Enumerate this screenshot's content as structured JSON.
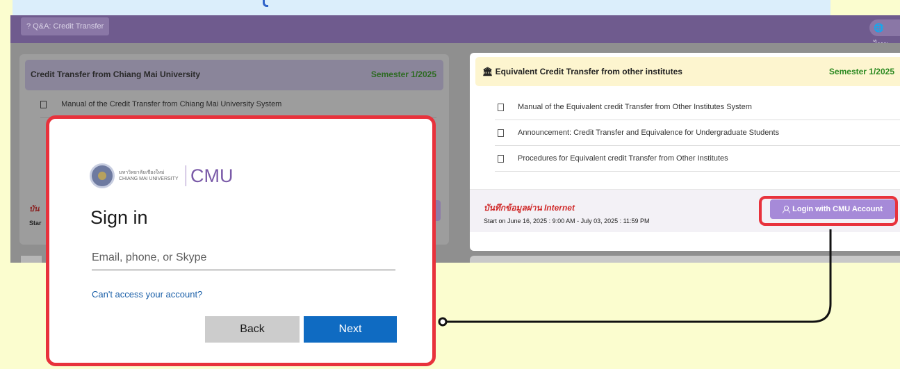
{
  "header": {
    "qa_button": "? Q&A: Credit Transfer",
    "language_button": "🌐 ไทย"
  },
  "left_panel": {
    "title": "Credit Transfer from Chiang Mai University",
    "semester": "Semester 1/2025",
    "items": [
      "Manual of the Credit Transfer from Chiang Mai University System"
    ],
    "record_fragment": "บัน",
    "start_fragment": "Star"
  },
  "right_panel": {
    "title": "Equivalent Credit Transfer from other institutes",
    "semester": "Semester 1/2025",
    "items": [
      "Manual of the Equivalent credit Transfer from Other Institutes System",
      "Announcement: Credit Transfer and Equivalence for Undergraduate Students",
      "Procedures for Equivalent credit Transfer from Other Institutes"
    ],
    "record_text": "บันทึกข้อมูลผ่าน Internet",
    "start_text": "Start on June 16, 2025 : 9:00 AM - July 03, 2025 : 11:59 PM",
    "login_button": "Login with CMU Account"
  },
  "signin": {
    "university_thai": "มหาวิทยาลัยเชียงใหม่",
    "university_en": "CHIANG MAI UNIVERSITY",
    "brand": "CMU",
    "title": "Sign in",
    "email_placeholder": "Email, phone, or Skype",
    "access_link": "Can't access your account?",
    "back_button": "Back",
    "next_button": "Next"
  },
  "colors": {
    "background": "#fbfdcf",
    "header_purple": "#6f5b8e",
    "highlight_red": "#e8323c",
    "next_blue": "#0f6bc2",
    "login_purple": "#a68ad8",
    "semester_green": "#2d8a22"
  }
}
